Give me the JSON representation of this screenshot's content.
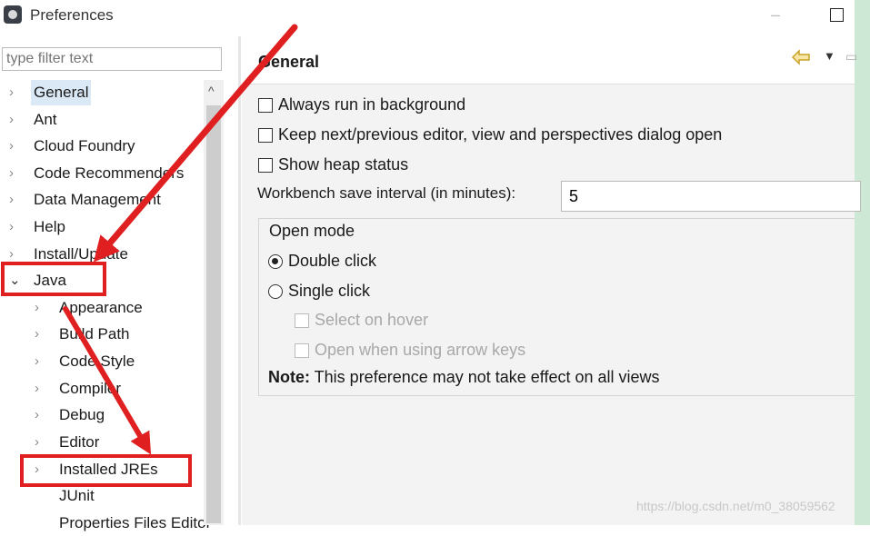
{
  "window": {
    "title": "Preferences",
    "minimize_glyph": "–",
    "maximize_label": "maximize"
  },
  "sidebar": {
    "filter_placeholder": "type filter text",
    "items": [
      {
        "label": "General",
        "expanded": false,
        "selected": true
      },
      {
        "label": "Ant",
        "expanded": false
      },
      {
        "label": "Cloud Foundry",
        "expanded": false
      },
      {
        "label": "Code Recommenders",
        "expanded": false
      },
      {
        "label": "Data Management",
        "expanded": false
      },
      {
        "label": "Help",
        "expanded": false
      },
      {
        "label": "Install/Update",
        "expanded": false
      },
      {
        "label": "Java",
        "expanded": true
      },
      {
        "label": "Appearance",
        "child": true
      },
      {
        "label": "Build Path",
        "child": true
      },
      {
        "label": "Code Style",
        "child": true
      },
      {
        "label": "Compiler",
        "child": true
      },
      {
        "label": "Debug",
        "child": true
      },
      {
        "label": "Editor",
        "child": true
      },
      {
        "label": "Installed JREs",
        "child": true
      },
      {
        "label": "JUnit",
        "child": true,
        "leaf": true
      },
      {
        "label": "Properties Files Editor",
        "child": true,
        "leaf": true
      }
    ]
  },
  "main": {
    "title": "General",
    "checkboxes": {
      "always_run_background": {
        "label": "Always run in background",
        "checked": false
      },
      "keep_next_prev": {
        "label": "Keep next/previous editor, view and perspectives dialog open",
        "checked": false
      },
      "show_heap": {
        "label": "Show heap status",
        "checked": false
      }
    },
    "interval": {
      "label": "Workbench save interval (in minutes):",
      "value": "5"
    },
    "open_mode": {
      "group_label": "Open mode",
      "double_click": {
        "label": "Double click",
        "selected": true
      },
      "single_click": {
        "label": "Single click",
        "selected": false
      },
      "select_on_hover": {
        "label": "Select on hover",
        "enabled": false
      },
      "open_arrow_keys": {
        "label": "Open when using arrow keys",
        "enabled": false
      }
    },
    "note": {
      "prefix": "Note:",
      "text": " This preference may not take effect on all views"
    }
  },
  "watermark": "https://blog.csdn.net/m0_38059562",
  "colors": {
    "annotation_red": "#e02020",
    "selection": "#dbe9f7",
    "side_strip": "#cde9d5"
  }
}
